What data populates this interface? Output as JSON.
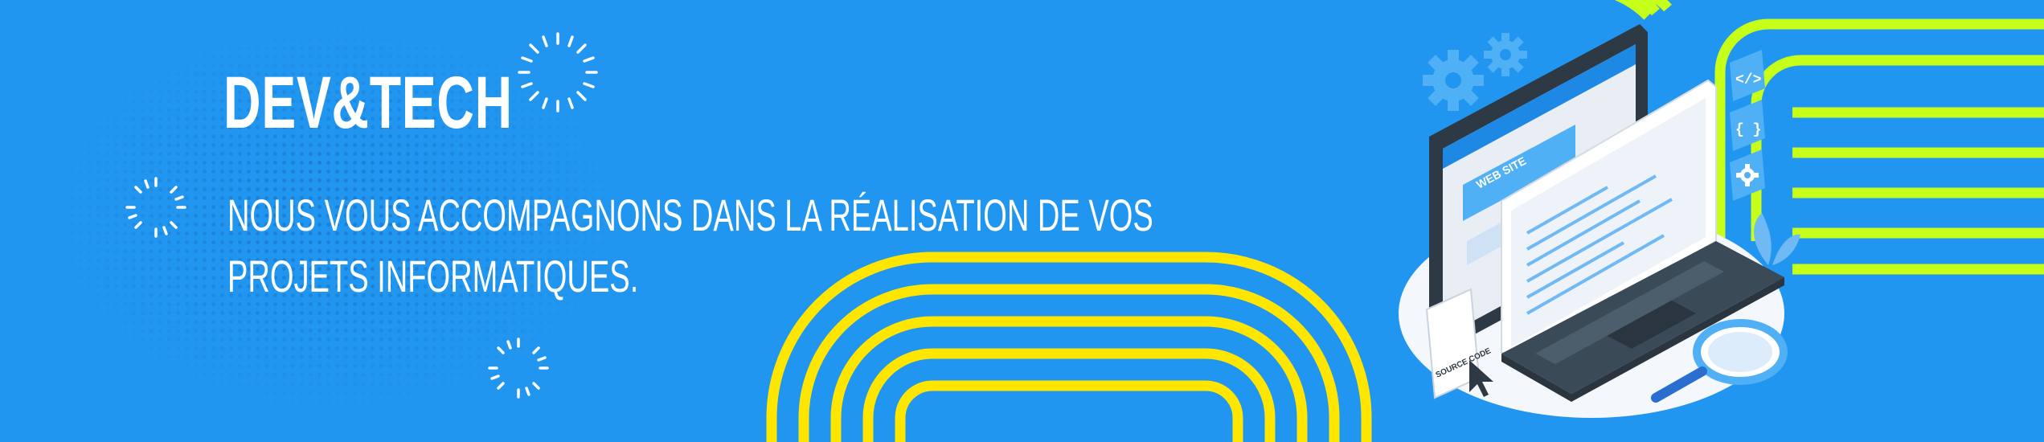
{
  "brand": {
    "title": "DEV&TECH"
  },
  "tagline": {
    "line1": "NOUS VOUS ACCOMPAGNONS DANS LA RÉALISATION DE VOS",
    "line2": "PROJETS INFORMATIQUES."
  },
  "illustration": {
    "website_label": "WEB SITE",
    "source_code_label": "SOURCE CODE",
    "badges": [
      "</>",
      "{ }"
    ]
  },
  "colors": {
    "background": "#2196f0",
    "accent_yellow": "#ffe600",
    "accent_green": "#c6ff1a",
    "text": "#ffffff",
    "laptop_dark": "#3b4a57"
  },
  "icons": [
    "sparkle-icon",
    "gear-icon",
    "magnifier-icon",
    "cursor-icon",
    "plant-icon"
  ]
}
